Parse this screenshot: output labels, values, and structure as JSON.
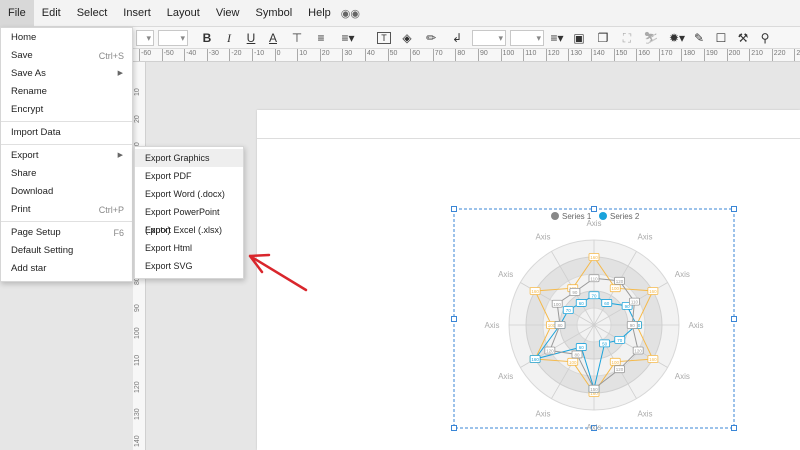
{
  "menubar": {
    "items": [
      "File",
      "Edit",
      "Select",
      "Insert",
      "Layout",
      "View",
      "Symbol",
      "Help"
    ]
  },
  "file_menu": {
    "items": [
      {
        "label": "Home",
        "shortcut": ""
      },
      {
        "label": "Save",
        "shortcut": "Ctrl+S"
      },
      {
        "label": "Save As",
        "shortcut": ""
      },
      {
        "label": "Rename",
        "shortcut": ""
      },
      {
        "label": "Encrypt",
        "shortcut": ""
      },
      {
        "label": "Import Data",
        "shortcut": ""
      },
      {
        "label": "Export",
        "shortcut": ""
      },
      {
        "label": "Share",
        "shortcut": ""
      },
      {
        "label": "Download",
        "shortcut": ""
      },
      {
        "label": "Print",
        "shortcut": "Ctrl+P"
      },
      {
        "label": "Page Setup",
        "shortcut": "F6"
      },
      {
        "label": "Default Setting",
        "shortcut": ""
      },
      {
        "label": "Add star",
        "shortcut": ""
      }
    ]
  },
  "export_menu": {
    "items": [
      "Export Graphics",
      "Export PDF",
      "Export Word (.docx)",
      "Export PowerPoint (.pptx)",
      "Export Excel (.xlsx)",
      "Export Html",
      "Export SVG"
    ]
  },
  "ruler": {
    "h_labels": [
      "-60",
      "-50",
      "-40",
      "-30",
      "-20",
      "-10",
      "0",
      "10",
      "20",
      "30",
      "40",
      "50",
      "60",
      "70",
      "80",
      "90",
      "100",
      "110",
      "120",
      "130",
      "140",
      "150",
      "160",
      "170",
      "180",
      "190",
      "200",
      "210",
      "220",
      "230"
    ],
    "v_labels": [
      "10",
      "20",
      "30",
      "40",
      "50",
      "60",
      "70",
      "80",
      "90",
      "100",
      "110",
      "120",
      "130",
      "140"
    ]
  },
  "colors": {
    "series1": "#f5b94a",
    "series2": "#1aa3db",
    "grey_series": "#999999",
    "arrow": "#d9262c",
    "selection": "#3a86d6"
  },
  "chart_data": {
    "type": "radar",
    "legend": [
      "Series 1",
      "Series 2"
    ],
    "axis_label": "Axis",
    "axes_count": 12,
    "rmax": 200,
    "series": [
      {
        "name": "Series 1",
        "values": [
          160,
          100,
          160,
          100,
          160,
          100,
          160,
          100,
          160,
          100,
          160,
          100
        ]
      },
      {
        "name": "Series 2",
        "values": [
          70,
          60,
          90,
          100,
          70,
          50,
          150,
          60,
          160,
          80,
          70,
          60
        ]
      },
      {
        "name": "",
        "values": [
          110,
          120,
          110,
          90,
          120,
          120,
          150,
          80,
          120,
          80,
          100,
          90
        ]
      }
    ]
  }
}
